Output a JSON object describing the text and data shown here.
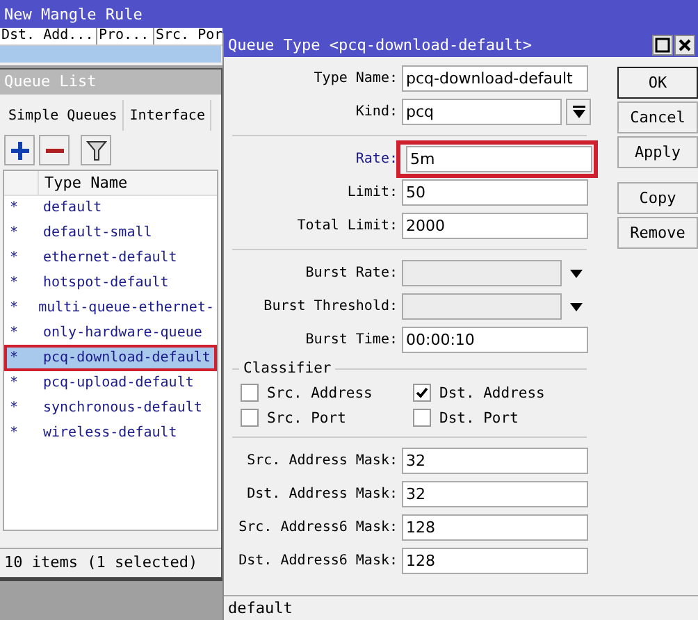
{
  "background_window": {
    "title": "New Mangle Rule",
    "columns": [
      "Dst. Add...",
      "Pro...",
      "Src. Por"
    ]
  },
  "queue_list": {
    "title": "Queue List",
    "tabs": [
      {
        "label": "Simple Queues",
        "selected": false
      },
      {
        "label": "Interface",
        "selected": false
      }
    ],
    "toolbar": [
      {
        "kind": "add"
      },
      {
        "kind": "remove"
      },
      {
        "kind": "filter"
      }
    ],
    "columns": [
      "Type Name"
    ],
    "rows": [
      {
        "marker": "*",
        "name": "default",
        "selected": false,
        "highlighted": false
      },
      {
        "marker": "*",
        "name": "default-small",
        "selected": false,
        "highlighted": false
      },
      {
        "marker": "*",
        "name": "ethernet-default",
        "selected": false,
        "highlighted": false
      },
      {
        "marker": "*",
        "name": "hotspot-default",
        "selected": false,
        "highlighted": false
      },
      {
        "marker": "*",
        "name": "multi-queue-ethernet-",
        "selected": false,
        "highlighted": false
      },
      {
        "marker": "*",
        "name": "only-hardware-queue",
        "selected": false,
        "highlighted": false
      },
      {
        "marker": "*",
        "name": "pcq-download-default",
        "selected": true,
        "highlighted": true
      },
      {
        "marker": "*",
        "name": "pcq-upload-default",
        "selected": false,
        "highlighted": false
      },
      {
        "marker": "*",
        "name": "synchronous-default",
        "selected": false,
        "highlighted": false
      },
      {
        "marker": "*",
        "name": "wireless-default",
        "selected": false,
        "highlighted": false
      }
    ],
    "status": "10 items (1 selected)"
  },
  "dialog": {
    "title": "Queue Type <pcq-download-default>",
    "fields": [
      {
        "kind": "text",
        "label": "Type Name:",
        "value": "pcq-download-default"
      },
      {
        "kind": "select",
        "label": "Kind:",
        "value": "pcq"
      },
      {
        "kind": "divider"
      },
      {
        "kind": "text",
        "label": "Rate:",
        "value": "5m",
        "highlighted": true
      },
      {
        "kind": "text",
        "label": "Limit:",
        "value": "50"
      },
      {
        "kind": "text",
        "label": "Total Limit:",
        "value": "2000"
      },
      {
        "kind": "divider"
      },
      {
        "kind": "combo",
        "label": "Burst Rate:"
      },
      {
        "kind": "combo",
        "label": "Burst Threshold:"
      },
      {
        "kind": "text",
        "label": "Burst Time:",
        "value": "00:00:10"
      },
      {
        "kind": "group",
        "label": "Classifier",
        "checkboxes": [
          {
            "label": "Src. Address",
            "checked": false
          },
          {
            "label": "Dst. Address",
            "checked": true
          },
          {
            "label": "Src. Port",
            "checked": false
          },
          {
            "label": "Dst. Port",
            "checked": false
          }
        ]
      },
      {
        "kind": "divider"
      },
      {
        "kind": "text",
        "label": "Src. Address Mask:",
        "value": "32"
      },
      {
        "kind": "text",
        "label": "Dst. Address Mask:",
        "value": "32"
      },
      {
        "kind": "text",
        "label": "Src. Address6 Mask:",
        "value": "128"
      },
      {
        "kind": "text",
        "label": "Dst. Address6 Mask:",
        "value": "128"
      }
    ],
    "buttons": [
      {
        "label": "OK",
        "default": true
      },
      {
        "label": "Cancel",
        "default": false
      },
      {
        "label": "Apply",
        "default": false
      },
      {
        "label": "Copy",
        "default": false
      },
      {
        "label": "Remove",
        "default": false
      }
    ],
    "status": "default"
  }
}
